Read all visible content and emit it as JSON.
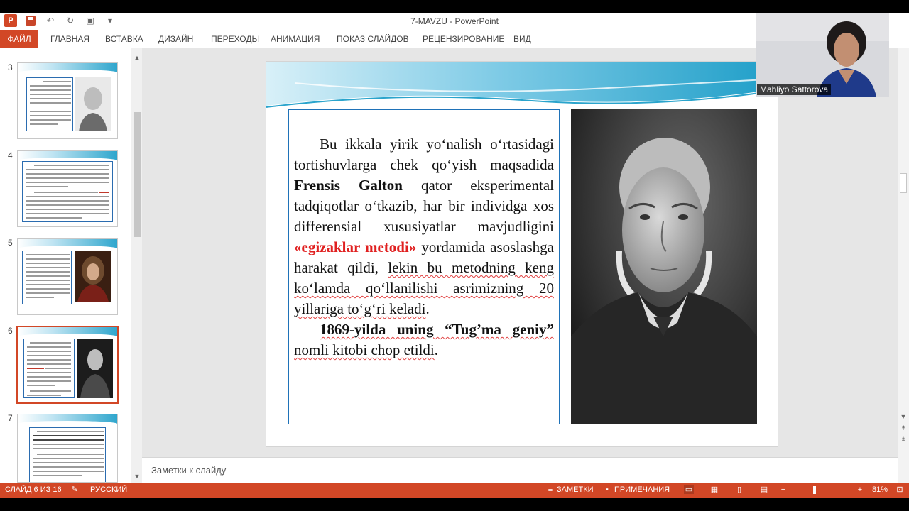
{
  "app": {
    "window_title": "7-MAVZU - PowerPoint",
    "app_icon_letter": "P"
  },
  "ribbon": {
    "tabs": [
      "ФАЙЛ",
      "ГЛАВНАЯ",
      "ВСТАВКА",
      "ДИЗАЙН",
      "ПЕРЕХОДЫ",
      "АНИМАЦИЯ",
      "ПОКАЗ СЛАЙДОВ",
      "РЕЦЕНЗИРОВАНИЕ",
      "ВИД"
    ]
  },
  "thumbnails": [
    {
      "number": "3",
      "selected": false
    },
    {
      "number": "4",
      "selected": false
    },
    {
      "number": "5",
      "selected": false
    },
    {
      "number": "6",
      "selected": true
    },
    {
      "number": "7",
      "selected": false
    }
  ],
  "slide": {
    "p1_part1": "Bu ikkala yirik yo‘nalish o‘rtasidagi tortishuvlarga chek qo‘yish maqsadida ",
    "p1_name": "Frensis Galton",
    "p1_part2": " qator eksperimental tadqiqotlar o‘tkazib, har bir individga xos differensial xususiyatlar mavjudligini ",
    "p1_method": "«egizaklar metodi»",
    "p1_part3": " yordamida asoslashga harakat qildi, ",
    "p1_part4": "lekin bu metodning keng ko‘lamda qo‘llanilishi asrimizning 20 yillariga to‘g‘ri keladi",
    "p1_end": ".",
    "p2_bold": "1869-yilda uning “Tug’ma geniy”",
    "p2_rest": " nomli kitobi chop etildi",
    "p2_end": "."
  },
  "notes": {
    "placeholder": "Заметки к слайду"
  },
  "webcam": {
    "name": "Mahliyo Sattorova"
  },
  "status": {
    "slide_counter": "СЛАЙД 6 ИЗ 16",
    "language": "РУССКИЙ",
    "notes_label": "ЗАМЕТКИ",
    "comments_label": "ПРИМЕЧАНИЯ",
    "zoom": "81%"
  },
  "colors": {
    "accent": "#d24726",
    "method_red": "#e02020",
    "textbox_border": "#1f72b8"
  }
}
